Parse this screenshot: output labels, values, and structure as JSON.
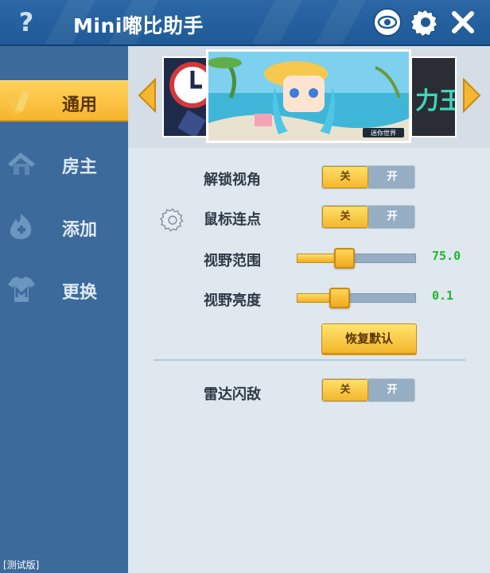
{
  "window": {
    "title": "Mini嘟比助手",
    "help_label": "?",
    "version_label": "[测试版]"
  },
  "toolbar": {
    "icons": [
      "eye-icon",
      "gear-icon",
      "close-icon"
    ]
  },
  "sidebar": {
    "items": [
      {
        "label": "通用",
        "icon": "pencil-ruler-icon",
        "active": true
      },
      {
        "label": "房主",
        "icon": "house-icon",
        "active": false
      },
      {
        "label": "添加",
        "icon": "flame-plus-icon",
        "active": false
      },
      {
        "label": "更换",
        "icon": "shirt-m-icon",
        "active": false
      }
    ]
  },
  "banner": {
    "main_caption": "迷你世界",
    "right_text": "力王"
  },
  "settings": {
    "unlock_view": {
      "label": "解锁视角",
      "off": "关",
      "on": "开",
      "state": "off"
    },
    "mouse_click": {
      "label": "鼠标连点",
      "off": "关",
      "on": "开",
      "state": "off"
    },
    "view_range": {
      "label": "视野范围",
      "value": "75.0",
      "fraction": 0.4
    },
    "view_brightness": {
      "label": "视野亮度",
      "value": "0.1",
      "fraction": 0.36
    },
    "reset_label": "恢复默认",
    "radar": {
      "label": "雷达闪敌",
      "off": "关",
      "on": "开",
      "state": "off"
    }
  },
  "colors": {
    "accent": "#f7b52e",
    "sidebar": "#3b6a9b",
    "titlebar": "#245f9e",
    "value_green": "#1db82a"
  }
}
